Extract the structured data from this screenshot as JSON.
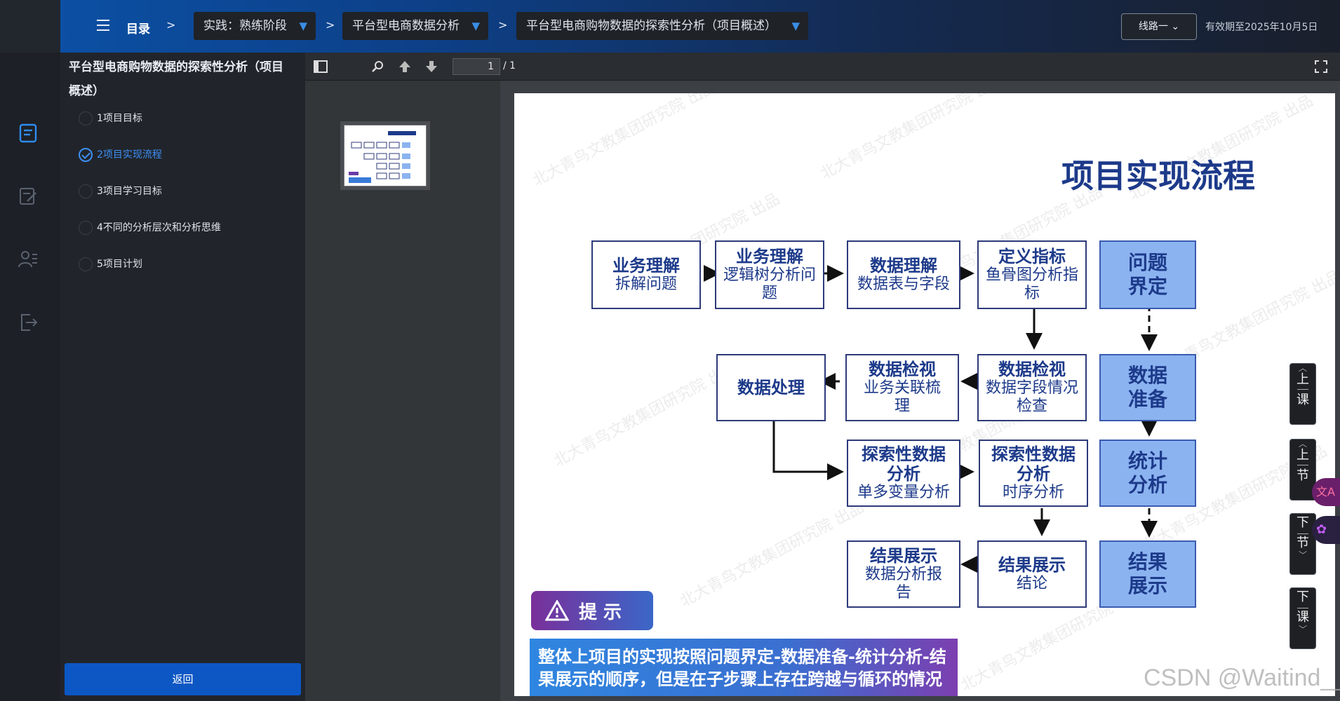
{
  "topbar": {
    "menu_label": "目录",
    "sep": ">",
    "dropdowns": [
      "实践：熟练阶段",
      "平台型电商数据分析",
      "平台型电商购物数据的探索性分析（项目概述）"
    ],
    "route_label": "线路一",
    "expiry": "有效期至2025年10月5日"
  },
  "rail": {
    "icons": [
      "document-icon",
      "edit-icon",
      "people-icon",
      "exit-icon"
    ]
  },
  "outline": {
    "title": "平台型电商购物数据的探索性分析（项目概述）",
    "items": [
      {
        "label": "1项目目标",
        "active": false
      },
      {
        "label": "2项目实现流程",
        "active": true
      },
      {
        "label": "3项目学习目标",
        "active": false
      },
      {
        "label": "4不同的分析层次和分析思维",
        "active": false
      },
      {
        "label": "5项目计划",
        "active": false
      }
    ],
    "back_label": "返回"
  },
  "pdf": {
    "page_current": "1",
    "page_total": "/ 1"
  },
  "slide": {
    "title": "项目实现流程",
    "watermark": "北大青鸟文教集团研究院 出品",
    "boxes": {
      "b1": {
        "t": "业务理解",
        "s": "拆解问题"
      },
      "b2": {
        "t": "业务理解",
        "s": "逻辑树分析问题"
      },
      "b3": {
        "t": "数据理解",
        "s": "数据表与字段"
      },
      "b4": {
        "t": "定义指标",
        "s": "鱼骨图分析指标"
      },
      "b5": {
        "t": "数据处理",
        "s": ""
      },
      "b6": {
        "t": "数据检视",
        "s": "业务关联梳理"
      },
      "b7": {
        "t": "数据检视",
        "s": "数据字段情况检查"
      },
      "b8": {
        "t": "探索性数据分析",
        "s": "单多变量分析"
      },
      "b9": {
        "t": "探索性数据分析",
        "s": "时序分析"
      },
      "b10": {
        "t": "结果展示",
        "s": "数据分析报告"
      },
      "b11": {
        "t": "结果展示",
        "s": "结论"
      },
      "s1": "问题界定",
      "s2": "数据准备",
      "s3": "统计分析",
      "s4": "结果展示"
    },
    "hint_label": "提  示",
    "hint_text": "整体上项目的实现按照问题界定-数据准备-统计分析-结果展示的顺序，但是在子步骤上存在跨越与循环的情况"
  },
  "side": {
    "prev_lesson": [
      "上",
      "课"
    ],
    "prev_section": [
      "上",
      "节"
    ],
    "next_section": [
      "下",
      "节"
    ],
    "next_lesson": [
      "下",
      "课"
    ],
    "float_1": "文A"
  },
  "csdn": "CSDN @Waitind__"
}
